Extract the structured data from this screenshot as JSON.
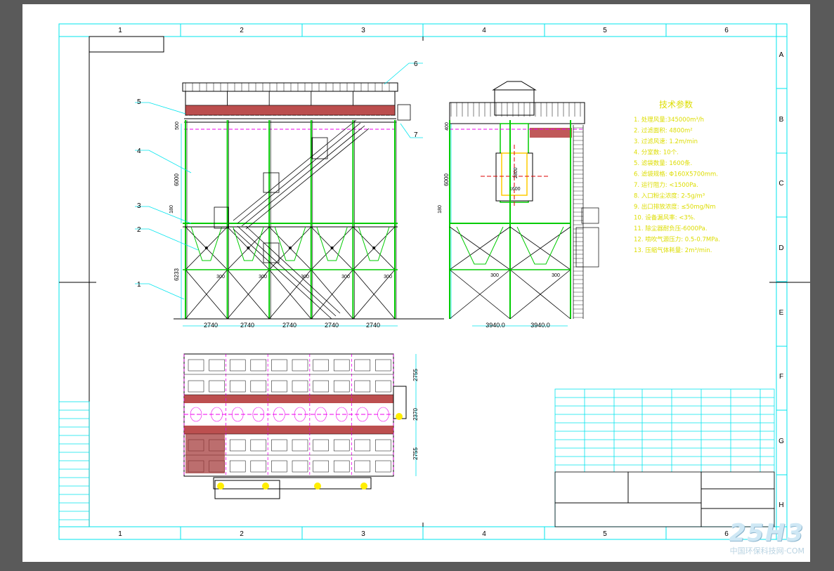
{
  "grid_cols": [
    "1",
    "2",
    "3",
    "4",
    "5",
    "6"
  ],
  "grid_rows": [
    "A",
    "B",
    "C",
    "D",
    "E",
    "F",
    "G",
    "H"
  ],
  "callouts": [
    "1",
    "2",
    "3",
    "4",
    "5",
    "6",
    "7"
  ],
  "dims": {
    "bay": "2740",
    "bay2": "3940.0",
    "h_upper": "6000",
    "h_lower": "6233",
    "h500": "500",
    "h180": "180",
    "h400": "400",
    "d300": "300",
    "d1600": "1600",
    "d2800": "2800",
    "p2755": "2755",
    "p2370": "2370"
  },
  "tech": {
    "title": "技术参数",
    "items": [
      "1. 处理风量:345000m³/h",
      "2. 过滤面积: 4800m²",
      "3. 过滤风速: 1.2m/min",
      "4. 分室数: 10个.",
      "5. 滤袋数量: 1600条.",
      "6. 滤袋规格: Φ160X5700mm.",
      "7. 运行阻力: <1500Pa.",
      "8. 入口粉尘浓度: 2-5g/m³",
      "9. 出口排放浓度: ≤50mg/Nm",
      "10. 设备漏风率: <3%.",
      "11. 除尘器耐负压-6000Pa.",
      "12. 喷吹气源压力: 0.5-0.7MPa.",
      "13. 压缩气体耗量: 2m³/min."
    ]
  },
  "watermark": {
    "logo": "25H3",
    "sub": "中国环保科技网·COM"
  },
  "colors": {
    "frame": "#00e5ee",
    "steel": "#00cc00",
    "red": "#aa1111",
    "magenta": "#e0e",
    "yellow": "#dddd00",
    "black": "#000000"
  }
}
